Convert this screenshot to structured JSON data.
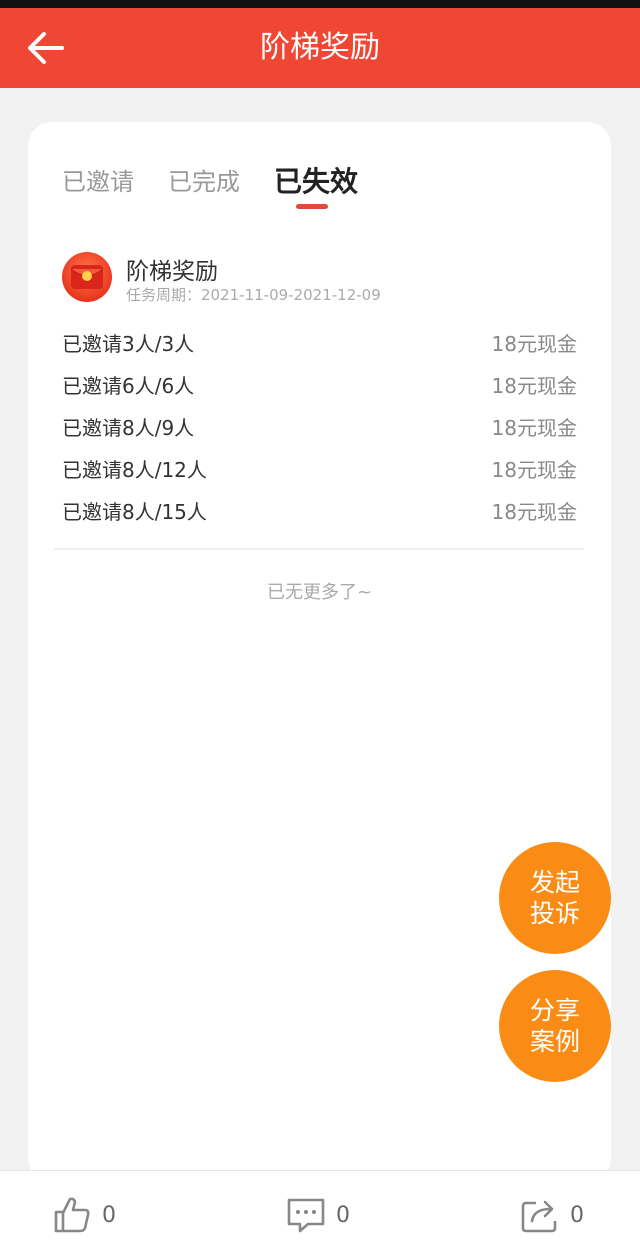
{
  "header": {
    "title": "阶梯奖励",
    "back_icon": "arrow-left-icon",
    "bg_color": "#f04634"
  },
  "tabs": [
    {
      "label": "已邀请",
      "active": false
    },
    {
      "label": "已完成",
      "active": false
    },
    {
      "label": "已失效",
      "active": true
    }
  ],
  "reward": {
    "icon": "red-envelope-icon",
    "title": "阶梯奖励",
    "period": "任务周期：2021-11-09-2021-12-09",
    "tiers": [
      {
        "label": "已邀请3人/3人",
        "reward": "18元现金"
      },
      {
        "label": "已邀请6人/6人",
        "reward": "18元现金"
      },
      {
        "label": "已邀请8人/9人",
        "reward": "18元现金"
      },
      {
        "label": "已邀请8人/12人",
        "reward": "18元现金"
      },
      {
        "label": "已邀请8人/15人",
        "reward": "18元现金"
      }
    ]
  },
  "no_more_text": "已无更多了~",
  "fabs": {
    "complaint_line1": "发起",
    "complaint_line2": "投诉",
    "share_line1": "分享",
    "share_line2": "案例",
    "color": "#fa8c16"
  },
  "bottom_bar": {
    "like_count": "0",
    "comment_count": "0",
    "share_count": "0"
  }
}
